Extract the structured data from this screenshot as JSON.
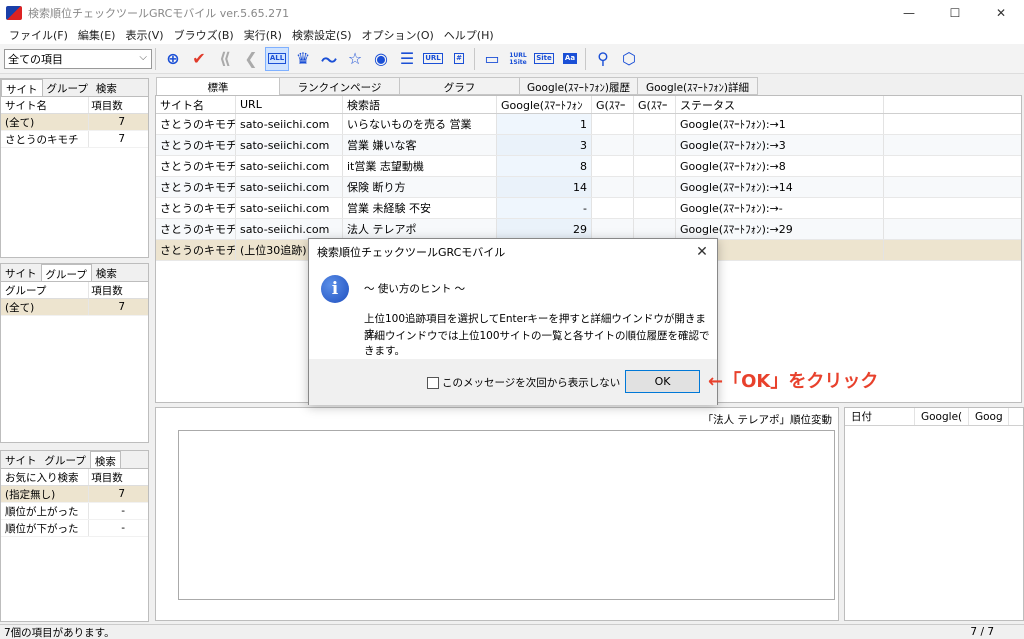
{
  "window": {
    "title": "検索順位チェックツールGRCモバイル ver.5.65.271",
    "min": "—",
    "max": "☐",
    "close": "✕"
  },
  "menu": [
    "ファイル(F)",
    "編集(E)",
    "表示(V)",
    "ブラウズ(B)",
    "実行(R)",
    "検索設定(S)",
    "オプション(O)",
    "ヘルプ(H)"
  ],
  "toolbar": {
    "select_value": "全ての項目",
    "all_label": "ALL",
    "url_label": "URL",
    "hash_label": "#",
    "url1site_label": "1URL\n1Site",
    "site_label": "Site",
    "aa_label": "Aa"
  },
  "panel_site": {
    "tabs": [
      "サイト",
      "グループ",
      "検索"
    ],
    "headers": [
      "サイト名",
      "項目数"
    ],
    "rows": [
      {
        "name": "(全て)",
        "count": "7"
      },
      {
        "name": "さとうのキモチ",
        "count": "7"
      }
    ]
  },
  "panel_group": {
    "tabs": [
      "サイト",
      "グループ",
      "検索"
    ],
    "headers": [
      "グループ",
      "項目数"
    ],
    "rows": [
      {
        "name": "(全て)",
        "count": "7"
      }
    ]
  },
  "panel_search": {
    "tabs": [
      "サイト",
      "グループ",
      "検索"
    ],
    "headers": [
      "お気に入り検索",
      "項目数"
    ],
    "rows": [
      {
        "name": "(指定無し)",
        "count": "7"
      },
      {
        "name": "順位が上がった",
        "count": "-"
      },
      {
        "name": "順位が下がった",
        "count": "-"
      }
    ]
  },
  "main_tabs": [
    "標準",
    "ランクインページ",
    "グラフ",
    "Google(ｽﾏｰﾄﾌｫﾝ)履歴",
    "Google(ｽﾏｰﾄﾌｫﾝ)詳細"
  ],
  "grid": {
    "headers": [
      "サイト名",
      "URL",
      "検索語",
      "Google(ｽﾏｰﾄﾌｫﾝ",
      "G(ｽﾏｰ",
      "G(ｽﾏｰ",
      "ステータス"
    ],
    "rows": [
      {
        "site": "さとうのキモチ",
        "url": "sato-seiichi.com",
        "kw": "いらないものを売る 営業",
        "g": "1",
        "g2": "",
        "g3": "",
        "status": "Google(ｽﾏｰﾄﾌｫﾝ):→1"
      },
      {
        "site": "さとうのキモチ",
        "url": "sato-seiichi.com",
        "kw": "営業 嫌いな客",
        "g": "3",
        "g2": "",
        "g3": "",
        "status": "Google(ｽﾏｰﾄﾌｫﾝ):→3"
      },
      {
        "site": "さとうのキモチ",
        "url": "sato-seiichi.com",
        "kw": "it営業 志望動機",
        "g": "8",
        "g2": "",
        "g3": "",
        "status": "Google(ｽﾏｰﾄﾌｫﾝ):→8"
      },
      {
        "site": "さとうのキモチ",
        "url": "sato-seiichi.com",
        "kw": "保険 断り方",
        "g": "14",
        "g2": "",
        "g3": "",
        "status": "Google(ｽﾏｰﾄﾌｫﾝ):→14"
      },
      {
        "site": "さとうのキモチ",
        "url": "sato-seiichi.com",
        "kw": "営業 未経験 不安",
        "g": "-",
        "g2": "",
        "g3": "",
        "status": "Google(ｽﾏｰﾄﾌｫﾝ):→-"
      },
      {
        "site": "さとうのキモチ",
        "url": "sato-seiichi.com",
        "kw": "法人 テレアポ",
        "g": "29",
        "g2": "",
        "g3": "",
        "status": "Google(ｽﾏｰﾄﾌｫﾝ):→29"
      },
      {
        "site": "さとうのキモチ",
        "url": "(上位30追跡)",
        "kw": "",
        "g": "",
        "g2": "",
        "g3": "",
        "status": ""
      }
    ]
  },
  "chart": {
    "title": "「法人 テレアポ」順位変動"
  },
  "history": {
    "headers": [
      "日付",
      "Google(",
      "Goog"
    ]
  },
  "status": {
    "left": "7個の項目があります。",
    "right": "7 / 7"
  },
  "dialog": {
    "title": "検索順位チェックツールGRCモバイル",
    "heading": "～ 使い方のヒント ～",
    "line1": "上位100追跡項目を選択してEnterキーを押すと詳細ウインドウが開きます。",
    "line2": "詳細ウインドウでは上位100サイトの一覧と各サイトの順位履歴を確認できます。",
    "checkbox_label": "このメッセージを次回から表示しない",
    "ok_label": "OK"
  },
  "annotation": "←「OK」をクリック"
}
